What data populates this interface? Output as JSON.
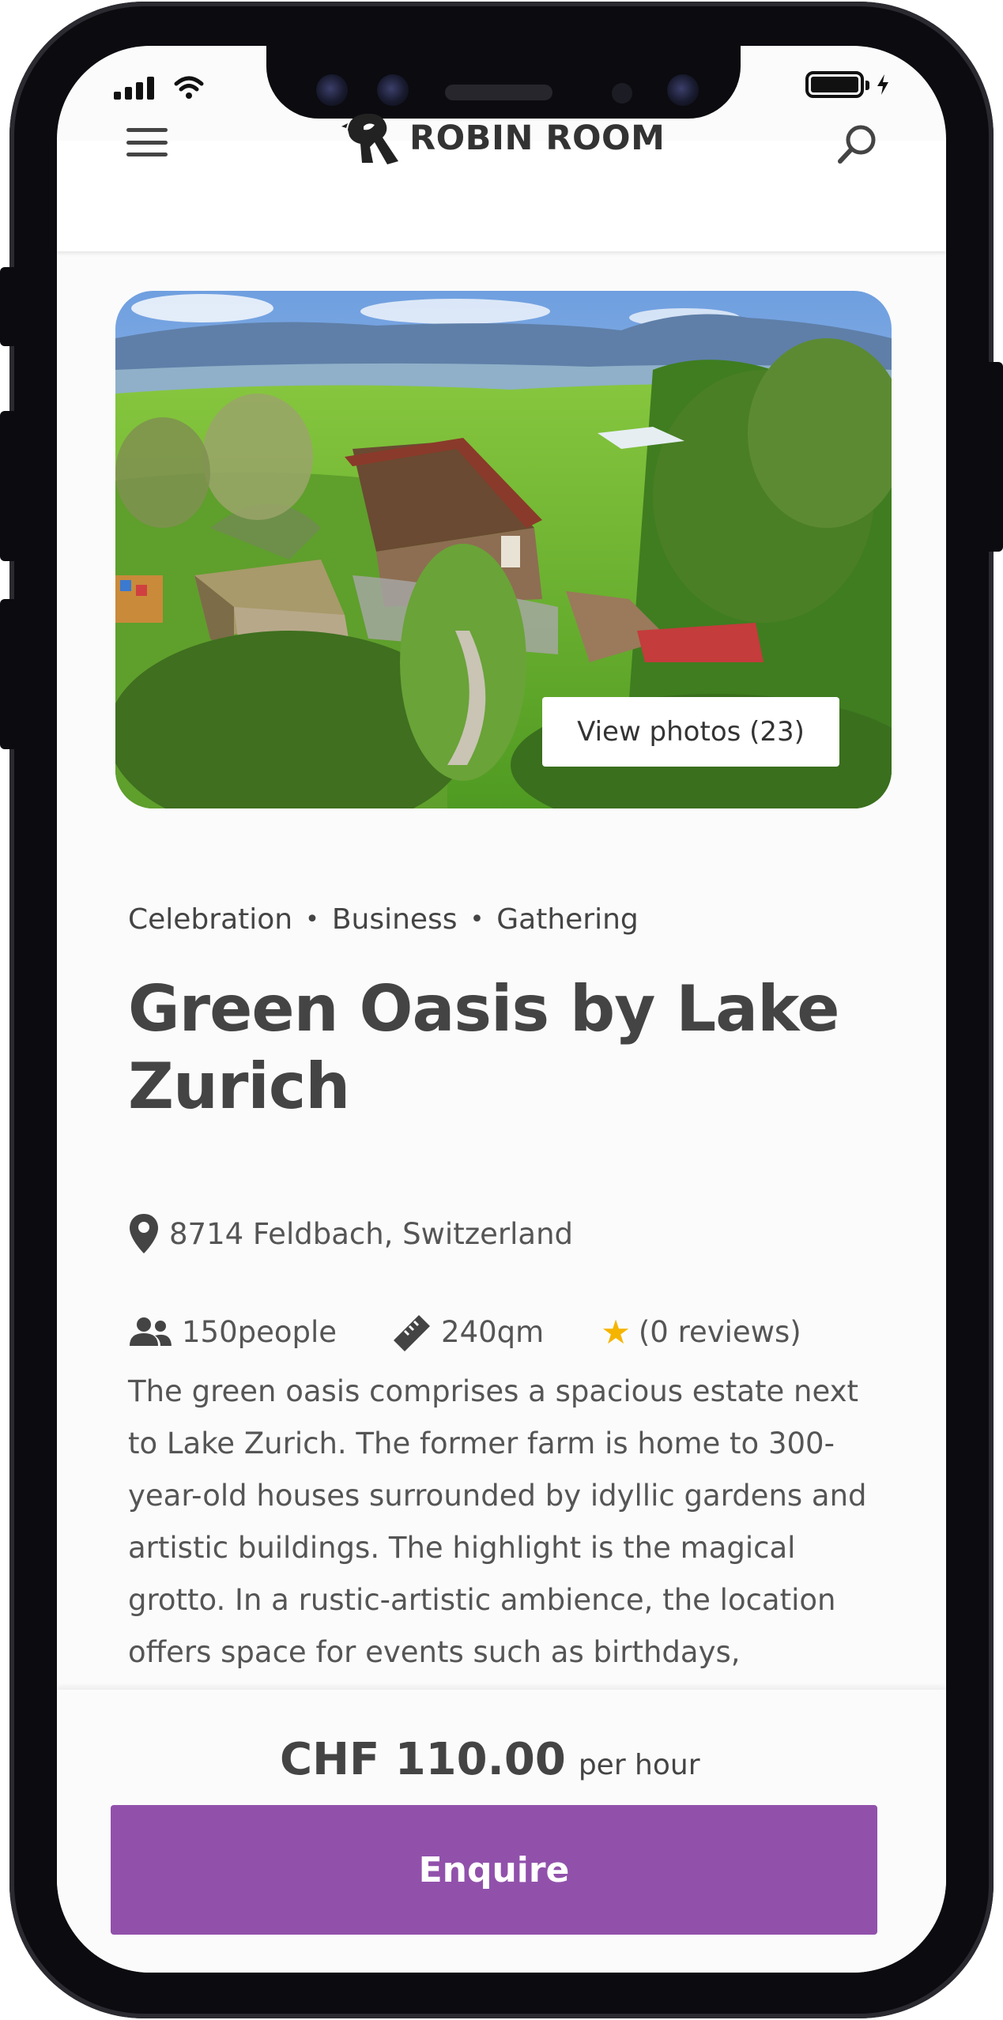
{
  "header": {
    "brand": "ROBIN ROOM",
    "menu_icon": "hamburger-menu-icon",
    "search_icon": "search-icon"
  },
  "hero": {
    "view_photos_label": "View photos (23)"
  },
  "listing": {
    "tags": [
      "Celebration",
      "Business",
      "Gathering"
    ],
    "tag_separator": "•",
    "title": "Green Oasis by Lake Zurich",
    "location": "8714 Feldbach, Switzerland",
    "capacity": "150people",
    "size": "240qm",
    "rating_star": "★",
    "reviews": "(0 reviews)",
    "description": "The green oasis comprises a spacious estate next to Lake Zurich. The former farm is home to 300-year-old houses surrounded by idyllic gardens and artistic buildings. The highlight is the magical grotto. In a rustic-artistic ambience, the location offers space for events such as birthdays,"
  },
  "booking": {
    "price": "CHF 110.00",
    "price_unit": "per hour",
    "enquire_label": "Enquire"
  },
  "colors": {
    "accent": "#9151ab",
    "star": "#f5b400",
    "text": "#444444"
  }
}
